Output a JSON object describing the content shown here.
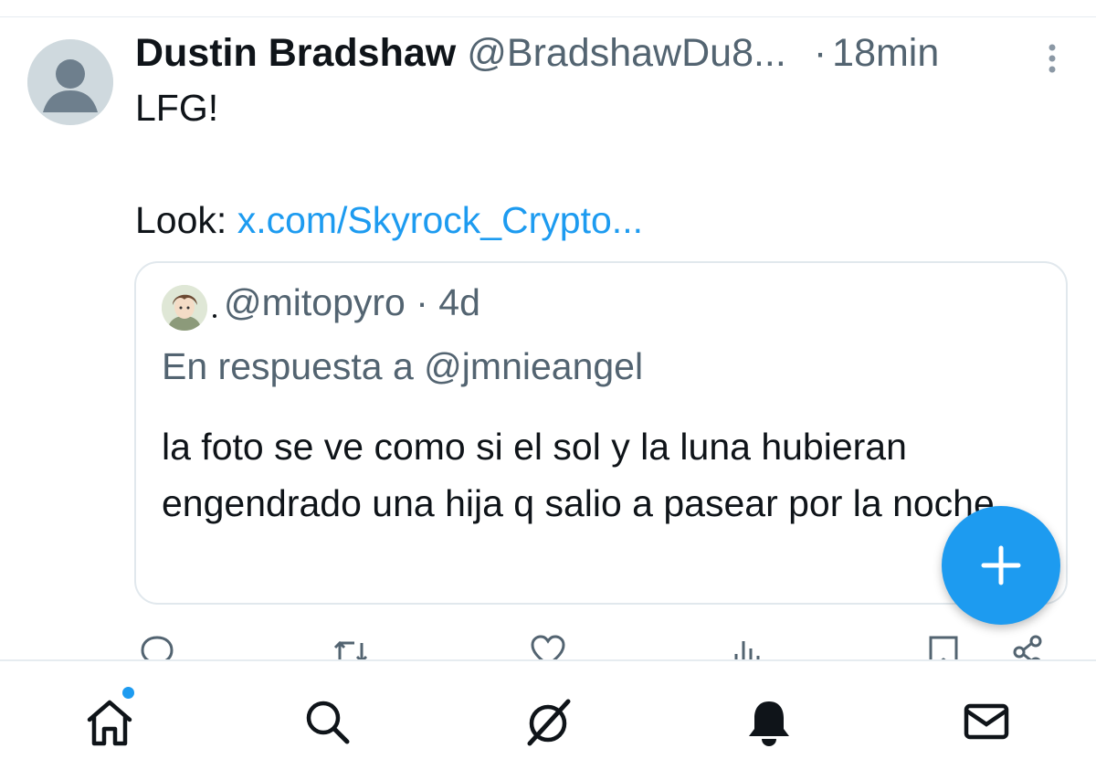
{
  "post": {
    "author_name": "Dustin Bradshaw",
    "author_handle": "@BradshawDu8...",
    "separator": "·",
    "time": "18min",
    "text_line1": "LFG!",
    "text_line2_prefix": "Look: ",
    "link_text": "x.com/Skyrock_Crypto..."
  },
  "quoted": {
    "header": "@mitopyro · 4d",
    "reply_to": "En respuesta a @jmnieangel",
    "text": "la foto se ve como si el sol y la luna hubieran engendrado una hija q salio a pasear por la noche"
  },
  "actions": [
    "reply-icon",
    "retweet-icon",
    "like-icon",
    "views-icon",
    "bookmark-icon",
    "share-icon"
  ],
  "nav": [
    "home-icon",
    "search-icon",
    "grok-icon",
    "notifications-icon",
    "messages-icon"
  ],
  "colors": {
    "accent": "#1d9bf0",
    "text": "#0f1419",
    "secondary": "#536471",
    "border": "#e1e8ed"
  }
}
